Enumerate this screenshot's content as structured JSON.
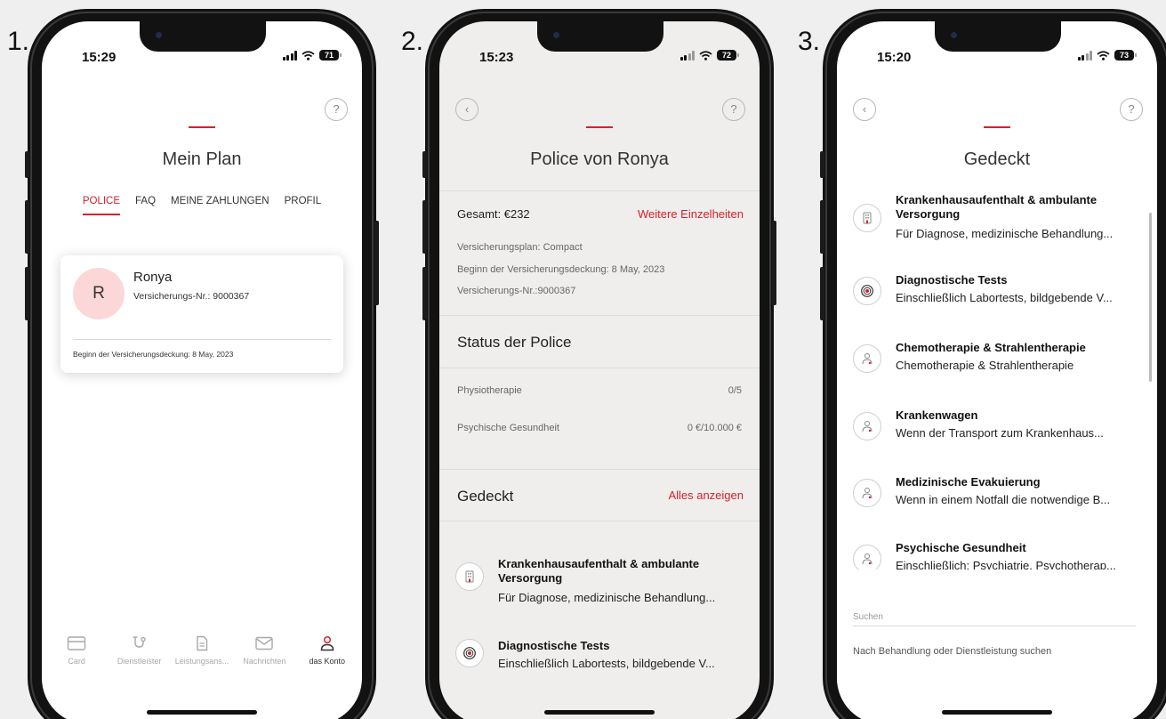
{
  "step_labels": [
    "1.",
    "2.",
    "3."
  ],
  "screen1": {
    "status": {
      "time": "15:29",
      "battery": "71"
    },
    "help_icon": "question-icon",
    "title": "Mein Plan",
    "tabs": [
      "POLICE",
      "FAQ",
      "MEINE ZAHLUNGEN",
      "PROFIL"
    ],
    "active_tab": "POLICE",
    "card": {
      "avatar_letter": "R",
      "name": "Ronya",
      "insurance_number": "Versicherungs-Nr.: 9000367",
      "coverage_start": "Beginn der Versicherungsdeckung: 8 May, 2023"
    },
    "nav": [
      {
        "label": "Card",
        "icon": "card-icon"
      },
      {
        "label": "Dienstleister",
        "icon": "stethoscope-icon"
      },
      {
        "label": "Leistungsans...",
        "icon": "document-icon"
      },
      {
        "label": "Nachrichten",
        "icon": "envelope-icon"
      },
      {
        "label": "das Konto",
        "icon": "person-icon"
      }
    ]
  },
  "screen2": {
    "status": {
      "time": "15:23",
      "battery": "72"
    },
    "title": "Police von Ronya",
    "total": "Gesamt: €232",
    "more_details": "Weitere Einzelheiten",
    "plan": "Versicherungsplan: Compact",
    "coverage_start": "Beginn der Versicherungsdeckung: 8 May, 2023",
    "insurance_number": "Versicherungs-Nr.:9000367",
    "status_heading": "Status der Police",
    "status_rows": [
      {
        "label": "Physiotherapie",
        "value": "0/5"
      },
      {
        "label": "Psychische Gesundheit",
        "value": "0 €/10.000 €"
      }
    ],
    "covered_heading": "Gedeckt",
    "show_all": "Alles anzeigen",
    "covered_items": [
      {
        "title": "Krankenhausaufenthalt & ambulante Versorgung",
        "desc": "Für Diagnose, medizinische Behandlung...",
        "icon": "hospital-icon"
      },
      {
        "title": "Diagnostische Tests",
        "desc": "Einschließlich Labortests, bildgebende V...",
        "icon": "target-icon"
      }
    ]
  },
  "screen3": {
    "status": {
      "time": "15:20",
      "battery": "73"
    },
    "title": "Gedeckt",
    "covered_items": [
      {
        "title": "Krankenhausaufenthalt & ambulante Versorgung",
        "desc": "Für Diagnose, medizinische Behandlung...",
        "icon": "hospital-icon"
      },
      {
        "title": "Diagnostische Tests",
        "desc": "Einschließlich Labortests, bildgebende V...",
        "icon": "target-icon"
      },
      {
        "title": "Chemotherapie & Strahlentherapie",
        "desc": "Chemotherapie & Strahlentherapie",
        "icon": "doctor-icon"
      },
      {
        "title": "Krankenwagen",
        "desc": "Wenn der Transport zum Krankenhaus...",
        "icon": "doctor-icon"
      },
      {
        "title": "Medizinische Evakuierung",
        "desc": "Wenn in einem Notfall die notwendige B...",
        "icon": "doctor-icon"
      },
      {
        "title": "Psychische Gesundheit",
        "desc": "Einschließlich: Psychiatrie, Psychotherap...",
        "icon": "doctor-icon"
      }
    ],
    "search_label": "Suchen",
    "search_placeholder": "Nach Behandlung oder Dienstleistung suchen"
  }
}
